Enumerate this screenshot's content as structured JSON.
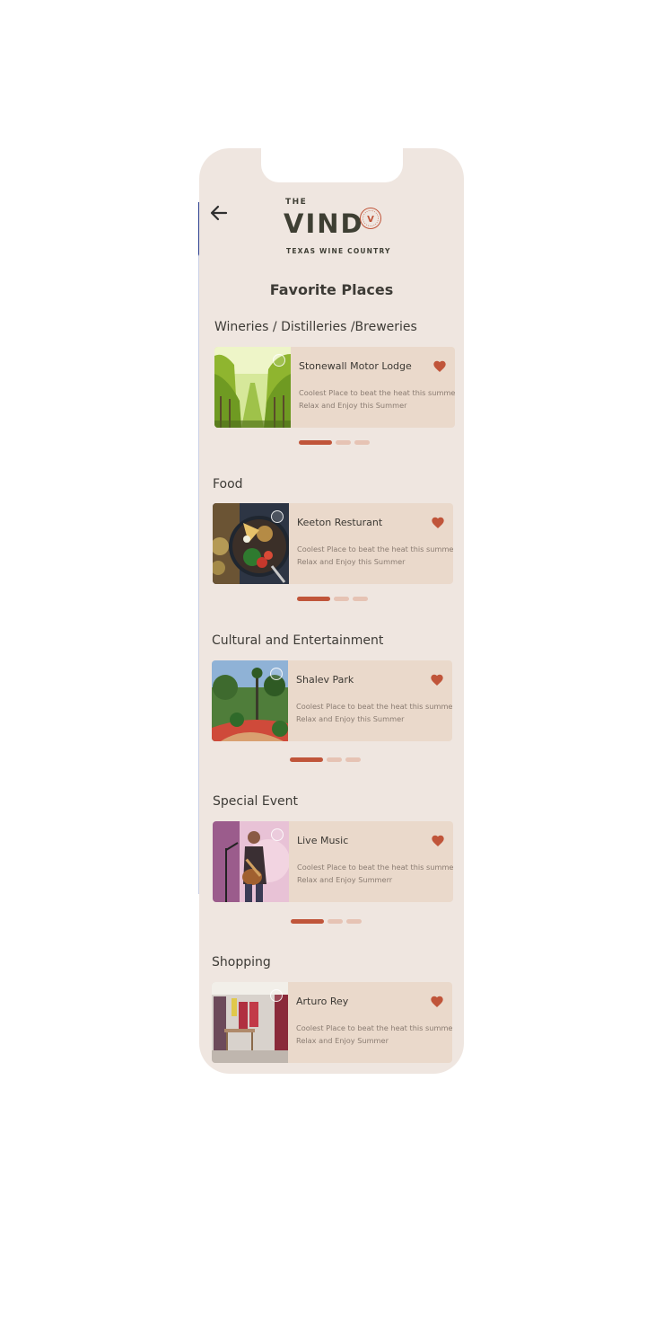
{
  "header": {
    "back_icon": "arrow-left-icon",
    "logo": {
      "the": "THE",
      "vind": "VIND",
      "badge_letter": "V",
      "subtitle": "TEXAS WINE COUNTRY"
    },
    "title": "Favorite Places"
  },
  "colors": {
    "background": "#efe6e0",
    "card": "#ead9cb",
    "accent": "#c0553a",
    "dot_inactive": "#e6c3b4",
    "text": "#3d3b36"
  },
  "sections": [
    {
      "title": "Wineries / Distilleries /Breweries",
      "card": {
        "name": "Stonewall Motor Lodge",
        "desc_line1": "Coolest Place to beat the heat this summer",
        "desc_line2": "Relax and Enjoy this Summer",
        "image": "vineyard-image",
        "favorite": true
      },
      "carousel": {
        "pages": 3,
        "active": 0
      }
    },
    {
      "title": "Food",
      "card": {
        "name": "Keeton Resturant",
        "desc_line1": "Coolest Place to beat the heat this summer.",
        "desc_line2": "Relax and Enjoy this  Summer",
        "image": "food-bowl-image",
        "favorite": true
      },
      "carousel": {
        "pages": 3,
        "active": 0
      }
    },
    {
      "title": "Cultural and Entertainment",
      "card": {
        "name": "Shalev  Park",
        "desc_line1": "Coolest Place to beat the heat this summer",
        "desc_line2": "Relax and Enjoy  this Summer",
        "image": "park-garden-image",
        "favorite": true
      },
      "carousel": {
        "pages": 3,
        "active": 0
      }
    },
    {
      "title": "Special Event",
      "card": {
        "name": "Live Music",
        "desc_line1": "Coolest Place to beat the heat this summer",
        "desc_line2": "Relax and Enjoy Summerr",
        "image": "guitarist-image",
        "favorite": true
      },
      "carousel": {
        "pages": 3,
        "active": 0
      }
    },
    {
      "title": "Shopping",
      "card": {
        "name": "Arturo Rey",
        "desc_line1": "Coolest Place to beat the heat this summer",
        "desc_line2": "Relax and Enjoy Summer",
        "image": "clothing-store-image",
        "favorite": true
      }
    }
  ]
}
